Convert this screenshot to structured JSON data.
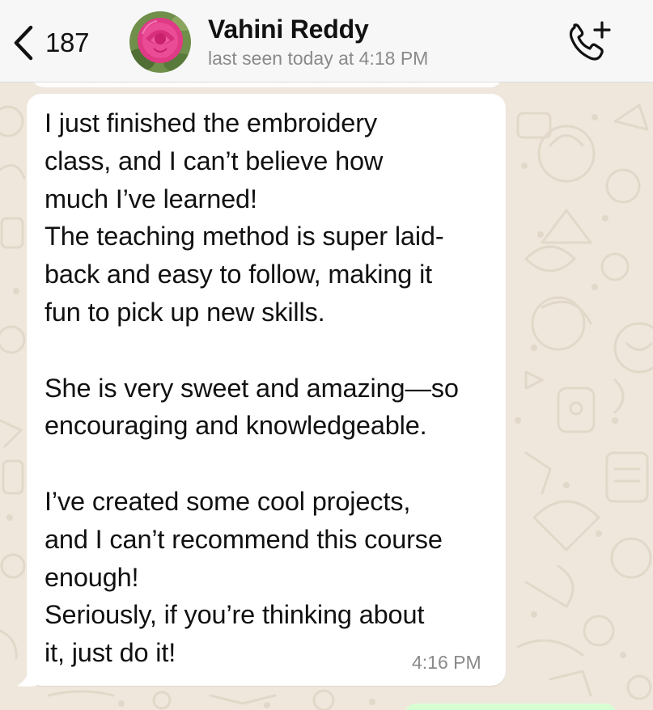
{
  "colors": {
    "wallpaper": "#efe7dc",
    "header_bg": "#f7f7f7",
    "incoming_bubble": "#ffffff",
    "outgoing_bubble": "#d9fdd3",
    "secondary_text": "#8a8a8a"
  },
  "header": {
    "back_icon": "chevron-left-icon",
    "unread_count": "187",
    "contact_name": "Vahini Reddy",
    "status": "last seen today at 4:18 PM",
    "call_icon": "phone-add-icon"
  },
  "message": {
    "text": "I just finished the embroidery\nclass, and I can’t believe how\nmuch I’ve learned!\nThe teaching method is super laid-\nback and easy to follow, making it\nfun to pick up new skills.\n\nShe is very sweet and amazing—so\nencouraging and knowledgeable.\n\nI’ve created some cool projects,\nand I can’t recommend this course\nenough!\nSeriously, if you’re thinking about\nit, just do it!",
    "time": "4:16 PM"
  }
}
